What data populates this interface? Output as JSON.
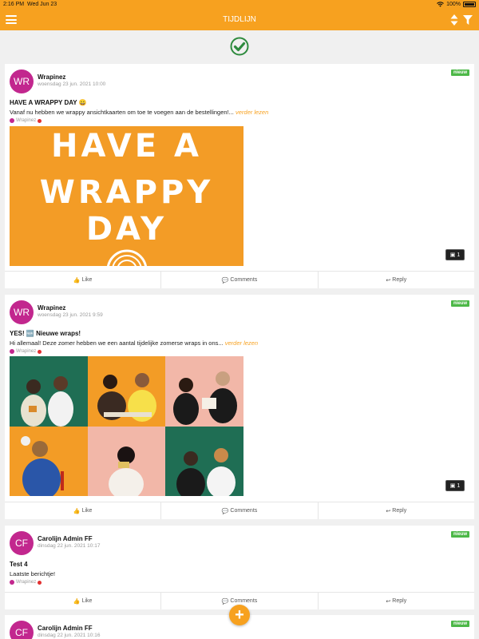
{
  "status_bar": {
    "time": "2:16 PM",
    "date": "Wed Jun 23",
    "battery": "100%"
  },
  "nav": {
    "title": "TIJDLIJN"
  },
  "colors": {
    "accent": "#f7a11f",
    "avatar": "#c2278e",
    "badge": "#4db848",
    "check": "#2e8b3e"
  },
  "posts": [
    {
      "initials": "WR",
      "author": "Wrapinez",
      "date": "woensdag 23 jun. 2021 10:00",
      "badge": "nieuw",
      "title": "HAVE A WRAPPY DAY 😀",
      "text": "Vanaf nu hebben we wrappy ansichtkaarten om toe te voegen aan de bestellingen!...",
      "more": "verder lezen",
      "group": "Wrapinez",
      "image_text": [
        "HAVE A",
        "WRAPPY DAY"
      ],
      "image_count": "1",
      "actions": {
        "like": "Like",
        "comments": "Comments",
        "reply": "Reply"
      }
    },
    {
      "initials": "WR",
      "author": "Wrapinez",
      "date": "woensdag 23 jun. 2021 9:59",
      "badge": "nieuw",
      "title": "YES! 🆕 Nieuwe wraps!",
      "text": "Hi allemaal! Deze zomer hebben we een aantal tijdelijke zomerse wraps in ons...",
      "more": "verder lezen",
      "group": "Wrapinez",
      "image_count": "1",
      "actions": {
        "like": "Like",
        "comments": "Comments",
        "reply": "Reply"
      }
    },
    {
      "initials": "CF",
      "author": "Carolijn Admin FF",
      "date": "dinsdag 22 jun. 2021 10:17",
      "badge": "nieuw",
      "title": "Test 4",
      "text": "Laatste berichtje!",
      "group": "Wrapinez",
      "actions": {
        "like": "Like",
        "comments": "Comments",
        "reply": "Reply"
      }
    },
    {
      "initials": "CF",
      "author": "Carolijn Admin FF",
      "date": "dinsdag 22 jun. 2021 10:16",
      "badge": "nieuw"
    }
  ]
}
